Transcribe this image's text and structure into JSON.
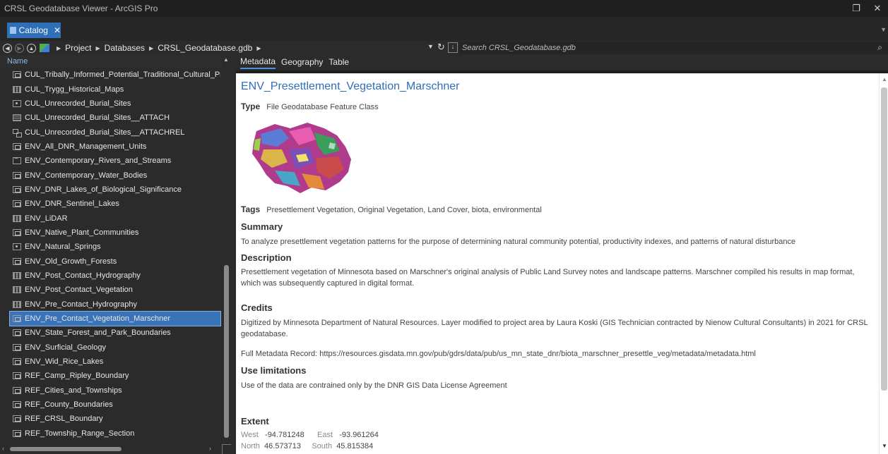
{
  "window": {
    "title": "CRSL Geodatabase Viewer - ArcGIS Pro",
    "restore_glyph": "❐",
    "close_glyph": "✕"
  },
  "tab": {
    "label": "Catalog",
    "close_glyph": "✕"
  },
  "breadcrumbs": [
    "Project",
    "Databases",
    "CRSL_Geodatabase.gdb"
  ],
  "search": {
    "placeholder": "Search CRSL_Geodatabase.gdb"
  },
  "tree": {
    "column_header": "Name",
    "items": [
      {
        "label": "CUL_Tribally_Informed_Potential_Traditional_Cultural_Property",
        "icon": "poly"
      },
      {
        "label": "CUL_Trygg_Historical_Maps",
        "icon": "raster"
      },
      {
        "label": "CUL_Unrecorded_Burial_Sites",
        "icon": "point"
      },
      {
        "label": "CUL_Unrecorded_Burial_Sites__ATTACH",
        "icon": "table"
      },
      {
        "label": "CUL_Unrecorded_Burial_Sites__ATTACHREL",
        "icon": "rel"
      },
      {
        "label": "ENV_All_DNR_Management_Units",
        "icon": "poly"
      },
      {
        "label": "ENV_Contemporary_Rivers_and_Streams",
        "icon": "line"
      },
      {
        "label": "ENV_Contemporary_Water_Bodies",
        "icon": "poly"
      },
      {
        "label": "ENV_DNR_Lakes_of_Biological_Significance",
        "icon": "poly"
      },
      {
        "label": "ENV_DNR_Sentinel_Lakes",
        "icon": "poly"
      },
      {
        "label": "ENV_LiDAR",
        "icon": "raster"
      },
      {
        "label": "ENV_Native_Plant_Communities",
        "icon": "poly"
      },
      {
        "label": "ENV_Natural_Springs",
        "icon": "point"
      },
      {
        "label": "ENV_Old_Growth_Forests",
        "icon": "poly"
      },
      {
        "label": "ENV_Post_Contact_Hydrography",
        "icon": "raster"
      },
      {
        "label": "ENV_Post_Contact_Vegetation",
        "icon": "raster"
      },
      {
        "label": "ENV_Pre_Contact_Hydrography",
        "icon": "raster"
      },
      {
        "label": "ENV_Pre_Contact_Vegetation_Marschner",
        "icon": "poly",
        "selected": true
      },
      {
        "label": "ENV_State_Forest_and_Park_Boundaries",
        "icon": "poly"
      },
      {
        "label": "ENV_Surficial_Geology",
        "icon": "poly"
      },
      {
        "label": "ENV_Wid_Rice_Lakes",
        "icon": "poly"
      },
      {
        "label": "REF_Camp_Ripley_Boundary",
        "icon": "poly"
      },
      {
        "label": "REF_Cities_and_Townships",
        "icon": "poly"
      },
      {
        "label": "REF_County_Boundaries",
        "icon": "poly"
      },
      {
        "label": "REF_CRSL_Boundary",
        "icon": "poly"
      },
      {
        "label": "REF_Township_Range_Section",
        "icon": "poly"
      }
    ]
  },
  "view_tabs": [
    "Metadata",
    "Geography",
    "Table"
  ],
  "metadata": {
    "title": "ENV_Presettlement_Vegetation_Marschner",
    "type_label": "Type",
    "type_value": "File Geodatabase Feature Class",
    "tags_label": "Tags",
    "tags_value": "Presettlement Vegetation, Original Vegetation, Land Cover, biota, environmental",
    "summary_heading": "Summary",
    "summary": "To analyze presettlement vegetation patterns for the purpose of determining natural community potential, productivity indexes, and patterns of natural disturbance",
    "description_heading": "Description",
    "description": "Presettlement vegetation of Minnesota based on Marschner's original analysis of Public Land Survey notes and landscape patterns. Marschner compiled his results in map format, which was subsequently captured in digital format.",
    "credits_heading": "Credits",
    "credits": "Digitized by Minnesota Department of Natural Resources. Layer modified to project area by Laura Koski (GIS Technician contracted by Nienow Cultural Consultants) in 2021 for CRSL geodatabase.",
    "full_record": "Full Metadata Record: https://resources.gisdata.mn.gov/pub/gdrs/data/pub/us_mn_state_dnr/biota_marschner_presettle_veg/metadata/metadata.html",
    "use_heading": "Use limitations",
    "use": "Use of the data are contrained only by the DNR GIS Data License Agreement",
    "extent_heading": "Extent",
    "extent": {
      "west_label": "West",
      "west": "-94.781248",
      "east_label": "East",
      "east": "-93.961264",
      "north_label": "North",
      "north": "46.573713",
      "south_label": "South",
      "south": "45.815384"
    }
  },
  "colors": {
    "accent": "#2f6fb8",
    "selection": "#3a74b8",
    "title_blue": "#2e6fb8"
  }
}
